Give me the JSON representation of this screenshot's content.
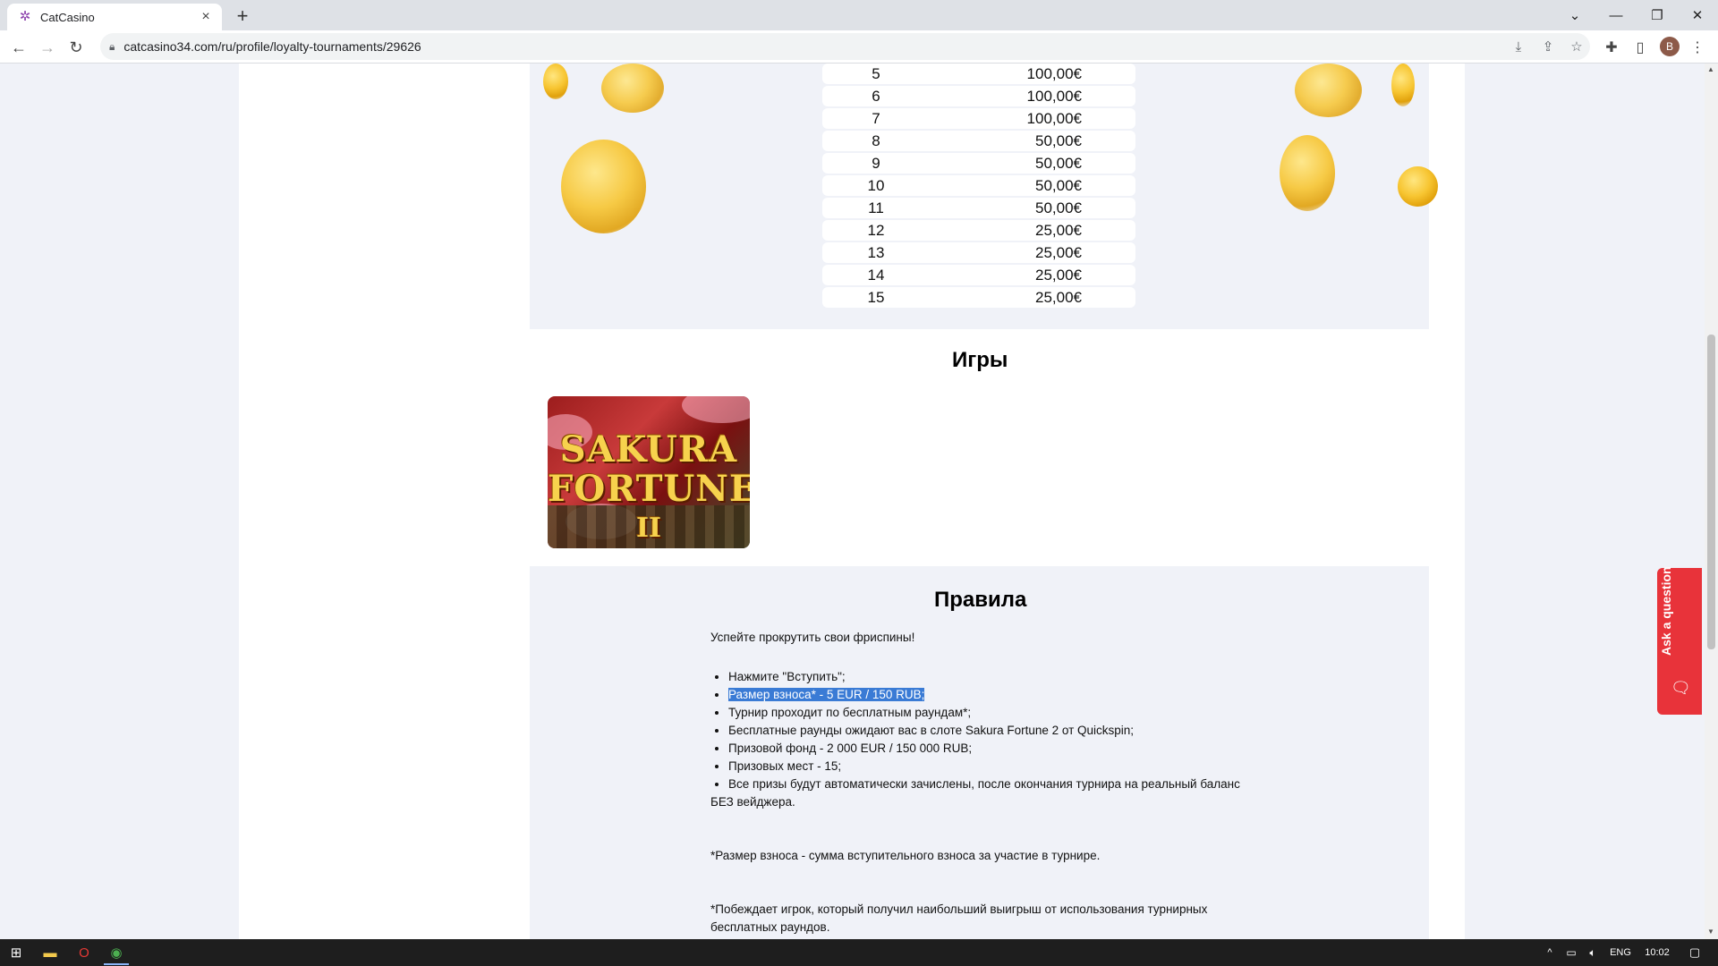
{
  "browser": {
    "tab_title": "CatCasino",
    "url": "catcasino34.com/ru/profile/loyalty-tournaments/29626",
    "avatar_letter": "B"
  },
  "prizes": [
    {
      "place": "5",
      "amount": "100,00€"
    },
    {
      "place": "6",
      "amount": "100,00€"
    },
    {
      "place": "7",
      "amount": "100,00€"
    },
    {
      "place": "8",
      "amount": "50,00€"
    },
    {
      "place": "9",
      "amount": "50,00€"
    },
    {
      "place": "10",
      "amount": "50,00€"
    },
    {
      "place": "11",
      "amount": "50,00€"
    },
    {
      "place": "12",
      "amount": "25,00€"
    },
    {
      "place": "13",
      "amount": "25,00€"
    },
    {
      "place": "14",
      "amount": "25,00€"
    },
    {
      "place": "15",
      "amount": "25,00€"
    }
  ],
  "games": {
    "title": "Игры",
    "card": {
      "line1": "SAKURA",
      "line2": "FORTUNE",
      "line3": "II"
    }
  },
  "rules": {
    "title": "Правила",
    "intro": "Успейте прокрутить свои фриспины!",
    "items": [
      "Нажмите \"Вступить\";",
      "Размер взноса* - 5 EUR / 150 RUB;",
      "Турнир проходит по бесплатным раундам*;",
      "Бесплатные раунды ожидают вас в слоте Sakura Fortune 2 от Quickspin;",
      "Призовой фонд - 2 000 EUR / 150 000 RUB;",
      "Призовых мест - 15;",
      "Все призы будут автоматически зачислены, после окончания турнира на реальный баланс"
    ],
    "continuation": "БЕЗ вейджера.",
    "note1": "*Размер взноса - сумма вступительного взноса за участие в турнире.",
    "note2": "*Побеждает игрок, который получил наибольший выигрыш от использования турнирных бесплатных раундов."
  },
  "ask_button": {
    "label": "Ask a question"
  },
  "taskbar": {
    "lang": "ENG",
    "time": "10:02"
  }
}
